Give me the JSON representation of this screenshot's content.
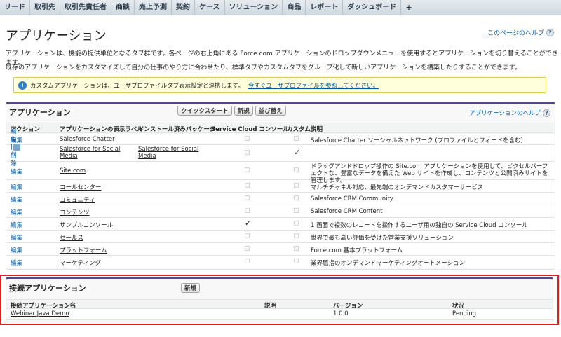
{
  "nav": {
    "tabs": [
      "リード",
      "取引先",
      "取引先責任者",
      "商談",
      "売上予測",
      "契約",
      "ケース",
      "ソリューション",
      "商品",
      "レポート",
      "ダッシュボード",
      "+"
    ]
  },
  "header": {
    "title": "アプリケーション",
    "help_link": "このページのヘルプ",
    "help_icon": "?"
  },
  "description": {
    "line1": "アプリケーションは、機能の提供単位となるタブ群です。各ページの右上角にある Force.com アプリケーションのドロップダウンメニューを使用するとアプリケーションを切り替えることができます。",
    "line2": "既存のアプリケーションをカスタマイズして自分の仕事のやり方に合わせたり、標準タブやカスタムタブをグループ化して新しいアプリケーションを構築したりすることができます。"
  },
  "info": {
    "icon": "i",
    "text": "カスタムアプリケーションは、ユーザプロファイルタブ表示設定と連携します。",
    "link": "今すぐユーザプロファイルを参照してください。"
  },
  "apps": {
    "title": "アプリケーション",
    "buttons": {
      "quickstart": "クイックスタート",
      "new": "新規",
      "reorder": "並び替え"
    },
    "help_link": "アプリケーションのヘルプ",
    "help_icon": "?",
    "columns": {
      "action": "アクション",
      "label": "アプリケーションの表示ラベル",
      "package": "インストール済みパッケージ",
      "service_cloud": "Service Cloud コンソール",
      "custom": "カスタム",
      "description": "説明"
    },
    "rows": [
      {
        "action": "編集",
        "label": "Salesforce Chatter",
        "package": "",
        "service_cloud": false,
        "custom": false,
        "description": "Salesforce Chatter ソーシャルネットワーク (プロファイルとフィードを含む)"
      },
      {
        "action": "編集 | 削除",
        "label": "Salesforce for Social Media",
        "package": "Salesforce for Social Media",
        "service_cloud": false,
        "custom": true,
        "description": ""
      },
      {
        "action": "編集",
        "label": "Site.com",
        "package": "",
        "service_cloud": false,
        "custom": false,
        "description": "ドラッグアンドドロップ操作の Site.com アプリケーションを使用して、ピクセルパーフェクトな、豊富なデータを備えた Web サイトを作成し、コンテンツと公開済みサイトを管理します。"
      },
      {
        "action": "編集",
        "label": "コールセンター",
        "package": "",
        "service_cloud": false,
        "custom": false,
        "description": "マルチチャネル対応、最先端のオンデマンドカスタマーサービス"
      },
      {
        "action": "編集",
        "label": "コミュニティ",
        "package": "",
        "service_cloud": false,
        "custom": false,
        "description": "Salesforce CRM Community"
      },
      {
        "action": "編集",
        "label": "コンテンツ",
        "package": "",
        "service_cloud": false,
        "custom": false,
        "description": "Salesforce CRM Content"
      },
      {
        "action": "編集",
        "label": "サンプルコンソール",
        "package": "",
        "service_cloud": true,
        "custom": false,
        "description": "1 画面で複数のレコードを操作するユーザ用の独自の Service Cloud コンソール"
      },
      {
        "action": "編集",
        "label": "セールス",
        "package": "",
        "service_cloud": false,
        "custom": false,
        "description": "世界で最も高い評価を受けた営業支援ソリューション"
      },
      {
        "action": "編集",
        "label": "プラットフォーム",
        "package": "",
        "service_cloud": false,
        "custom": false,
        "description": "Force.com 基本プラットフォーム"
      },
      {
        "action": "編集",
        "label": "マーケティング",
        "package": "",
        "service_cloud": false,
        "custom": false,
        "description": "業界屈指のオンデマンドマーケティングオートメーション"
      }
    ]
  },
  "connected_apps": {
    "title": "接続アプリケーション",
    "new_button": "新規",
    "columns": {
      "name": "接続アプリケーション名",
      "description": "説明",
      "version": "バージョン",
      "status": "状況"
    },
    "rows": [
      {
        "name": "Webinar Java Demo",
        "description": "",
        "version": "1.0.0",
        "status": "Pending"
      }
    ]
  },
  "colors": {
    "accent": "#56458c",
    "link": "#015ba7",
    "highlight_border": "#e02020",
    "info_bg": "#ffffdc"
  }
}
